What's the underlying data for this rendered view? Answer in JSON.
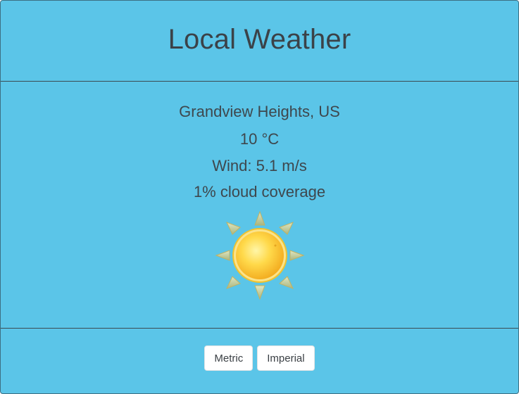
{
  "header": {
    "title": "Local Weather"
  },
  "weather": {
    "location": "Grandview Heights, US",
    "temperature": "10 °C",
    "wind": "Wind: 5.1 m/s",
    "cloud_coverage": "1% cloud coverage",
    "icon": "sun-icon"
  },
  "units": {
    "metric_label": "Metric",
    "imperial_label": "Imperial"
  },
  "colors": {
    "background": "#5bc5e8",
    "text": "#3b4248",
    "sun": "#ffd33f"
  }
}
